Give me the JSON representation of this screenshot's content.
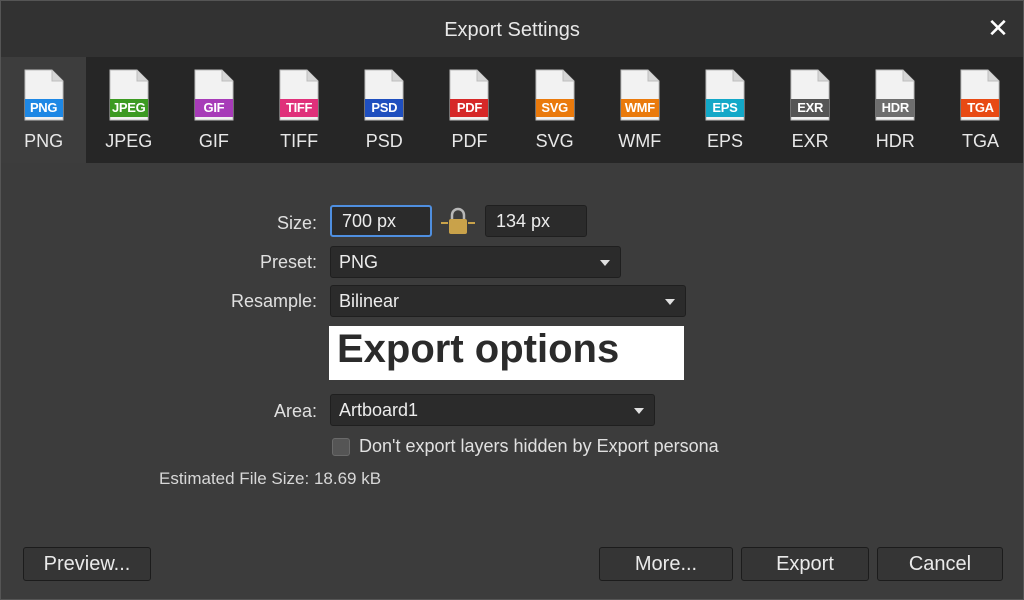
{
  "window": {
    "title": "Export Settings"
  },
  "formats": [
    {
      "tag": "PNG",
      "label": "PNG",
      "color": "#1e88e5",
      "selected": true
    },
    {
      "tag": "JPEG",
      "label": "JPEG",
      "color": "#3c9a22"
    },
    {
      "tag": "GIF",
      "label": "GIF",
      "color": "#a73bb8"
    },
    {
      "tag": "TIFF",
      "label": "TIFF",
      "color": "#e0307a"
    },
    {
      "tag": "PSD",
      "label": "PSD",
      "color": "#1f4fbf"
    },
    {
      "tag": "PDF",
      "label": "PDF",
      "color": "#d62828"
    },
    {
      "tag": "SVG",
      "label": "SVG",
      "color": "#ea7a0c"
    },
    {
      "tag": "WMF",
      "label": "WMF",
      "color": "#ea7a0c"
    },
    {
      "tag": "EPS",
      "label": "EPS",
      "color": "#13a8c8"
    },
    {
      "tag": "EXR",
      "label": "EXR",
      "color": "#555555"
    },
    {
      "tag": "HDR",
      "label": "HDR",
      "color": "#6e6e6e"
    },
    {
      "tag": "TGA",
      "label": "TGA",
      "color": "#e84a14"
    }
  ],
  "form": {
    "size_label": "Size:",
    "width_value": "700 px",
    "height_value": "134 px",
    "preset_label": "Preset:",
    "preset_value": "PNG",
    "resample_label": "Resample:",
    "resample_value": "Bilinear",
    "banner_text": "Export options",
    "area_label": "Area:",
    "area_value": "Artboard1",
    "checkbox_label": "Don't export layers hidden by Export persona",
    "checkbox_checked": false,
    "estimate_label": "Estimated File Size:",
    "estimate_value": "18.69 kB"
  },
  "buttons": {
    "preview": "Preview...",
    "more": "More...",
    "export": "Export",
    "cancel": "Cancel"
  },
  "colors": {
    "accent_focus": "#4f8fe0",
    "lock": "#c9a24a"
  },
  "icons": {
    "close": "close-icon",
    "lock": "lock-icon"
  }
}
